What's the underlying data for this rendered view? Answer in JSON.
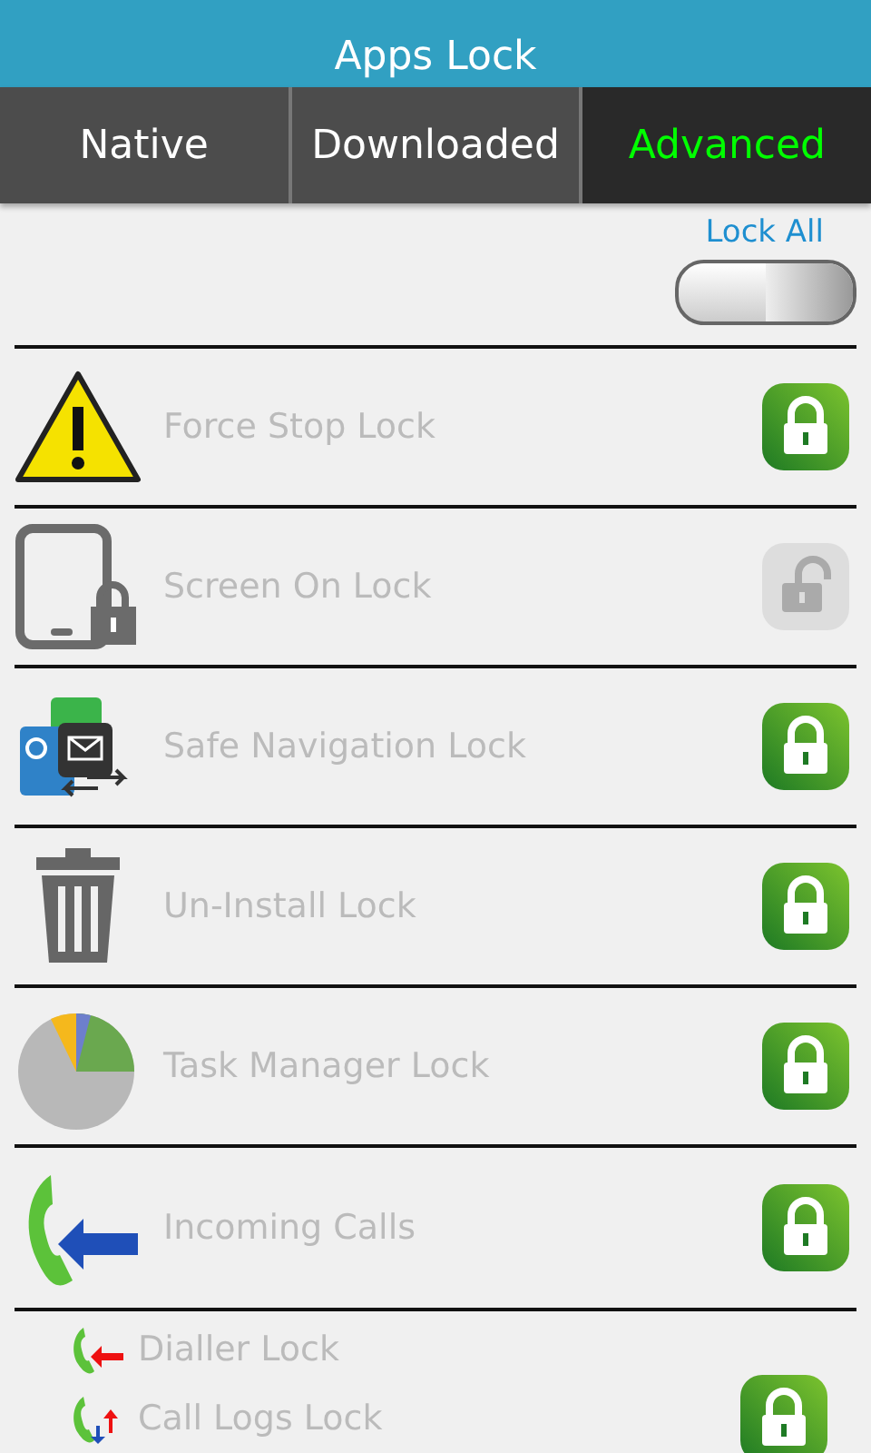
{
  "title": "Apps Lock",
  "tabs": [
    {
      "label": "Native",
      "selected": false
    },
    {
      "label": "Downloaded",
      "selected": false
    },
    {
      "label": "Advanced",
      "selected": true
    }
  ],
  "lock_all": {
    "label": "Lock All",
    "on": false
  },
  "items": [
    {
      "kind": "warning",
      "label": "Force Stop Lock",
      "locked": true
    },
    {
      "kind": "phone",
      "label": "Screen On Lock",
      "locked": false
    },
    {
      "kind": "apps",
      "label": "Safe Navigation Lock",
      "locked": true
    },
    {
      "kind": "trash",
      "label": "Un-Install Lock",
      "locked": true
    },
    {
      "kind": "pie",
      "label": "Task Manager Lock",
      "locked": true
    },
    {
      "kind": "call",
      "label": "Incoming Calls",
      "locked": true,
      "children": [
        {
          "kind": "dial",
          "label": "Dialler Lock"
        },
        {
          "kind": "logs",
          "label": "Call Logs Lock",
          "locked": true
        }
      ]
    }
  ]
}
